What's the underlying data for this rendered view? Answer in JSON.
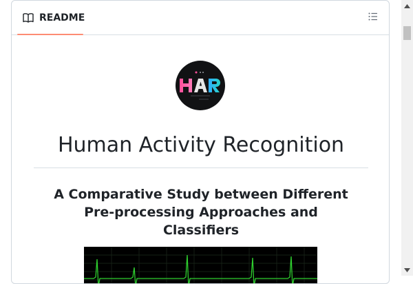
{
  "readme_tab": {
    "label": "README",
    "icon": "book-icon",
    "accent_color": "#fd8c73"
  },
  "outline_button": {
    "icon": "list-icon"
  },
  "logo": {
    "text": "HAR"
  },
  "readme": {
    "title": "Human Activity Recognition",
    "subtitle": "A Comparative Study between Different Pre-processing Approaches and Classifiers"
  },
  "colors": {
    "text": "#1f2328",
    "border": "#d0d7de",
    "ecg_line": "#2fd12f"
  }
}
